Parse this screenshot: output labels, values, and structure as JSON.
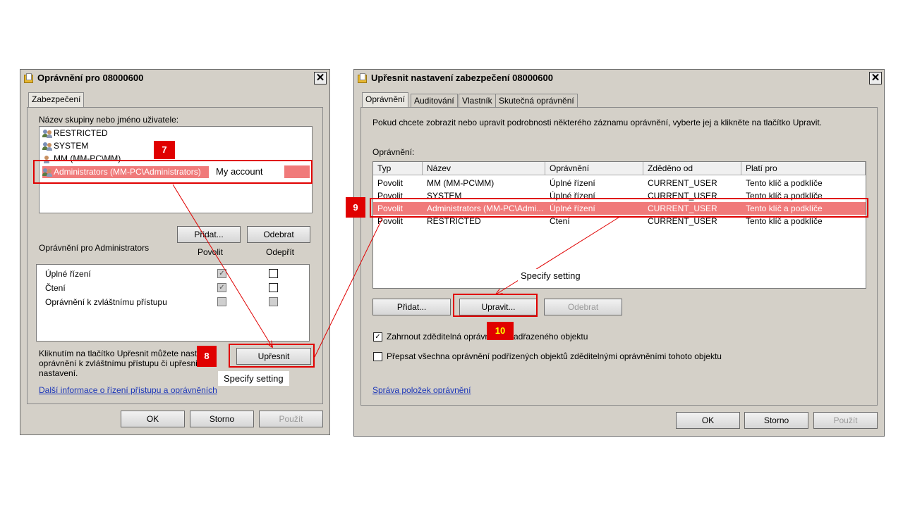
{
  "left_dialog": {
    "title": "Oprávnění pro 08000600",
    "close_label": "✕",
    "tab_label": "Zabezpečení",
    "group_label": "Název skupiny nebo jméno uživatele:",
    "users": [
      "RESTRICTED",
      "SYSTEM",
      "MM (MM-PC\\MM)",
      "Administrators (MM-PC\\Administrators)"
    ],
    "add_button": "Přidat...",
    "remove_button": "Odebrat",
    "permissions_for": "Oprávnění pro Administrators",
    "allow_header": "Povolit",
    "deny_header": "Odepřít",
    "permissions": [
      {
        "name": "Úplné řízení",
        "allow": true,
        "deny": false
      },
      {
        "name": "Čtení",
        "allow": true,
        "deny": false
      },
      {
        "name": "Oprávnění k zvláštnímu přístupu",
        "allow": false,
        "deny": false
      }
    ],
    "advanced_text_1": "Kliknutím na tlačítko Upřesnit můžete nasta",
    "advanced_text_2": "oprávnění k zvláštnímu přístupu či upřesni",
    "advanced_text_3": "nastavení.",
    "advanced_button": "Upřesnit",
    "link": "Další informace o řízení přístupu a oprávněních",
    "ok": "OK",
    "cancel": "Storno",
    "apply": "Použít"
  },
  "right_dialog": {
    "title": "Upřesnit nastavení zabezpečení 08000600",
    "close_label": "✕",
    "tabs": [
      "Oprávnění",
      "Auditování",
      "Vlastník",
      "Skutečná oprávnění"
    ],
    "info": "Pokud chcete zobrazit nebo upravit podrobnosti některého záznamu oprávnění, vyberte jej a klikněte na tlačítko Upravit.",
    "permissions_label": "Oprávnění:",
    "columns": [
      "Typ",
      "Název",
      "Oprávnění",
      "Zděděno od",
      "Platí pro"
    ],
    "rows": [
      [
        "Povolit",
        "MM (MM-PC\\MM)",
        "Úplné řízení",
        "CURRENT_USER",
        "Tento klíč a podklíče"
      ],
      [
        "Povolit",
        "SYSTEM",
        "Úplné řízení",
        "CURRENT_USER",
        "Tento klíč a podklíče"
      ],
      [
        "Povolit",
        "Administrators (MM-PC\\Admi...",
        "Úplné řízení",
        "CURRENT_USER",
        "Tento klíč a podklíče"
      ],
      [
        "Povolit",
        "RESTRICTED",
        "Čtení",
        "CURRENT_USER",
        "Tento klíč a podklíče"
      ]
    ],
    "add_button": "Přidat...",
    "edit_button": "Upravit...",
    "remove_button": "Odebrat",
    "inherit_a": "Zahrnout zděditelná oprávn",
    "inherit_b": "adřazeného objektu",
    "replace_label": "Přepsat všechna oprávnění podřízených objektů zděditelnými oprávněními tohoto objektu",
    "link": "Správa položek oprávnění",
    "ok": "OK",
    "cancel": "Storno",
    "apply": "Použít"
  },
  "annotations": {
    "badge_7": "7",
    "badge_8": "8",
    "badge_9": "9",
    "badge_10": "10",
    "my_account": "My account",
    "specify_setting_left": "Specify setting",
    "specify_setting_right": "Specify setting"
  },
  "colors": {
    "highlight": "#f07a7a",
    "annotation_red": "#e00000",
    "dialog_bg": "#d4d0c8"
  }
}
